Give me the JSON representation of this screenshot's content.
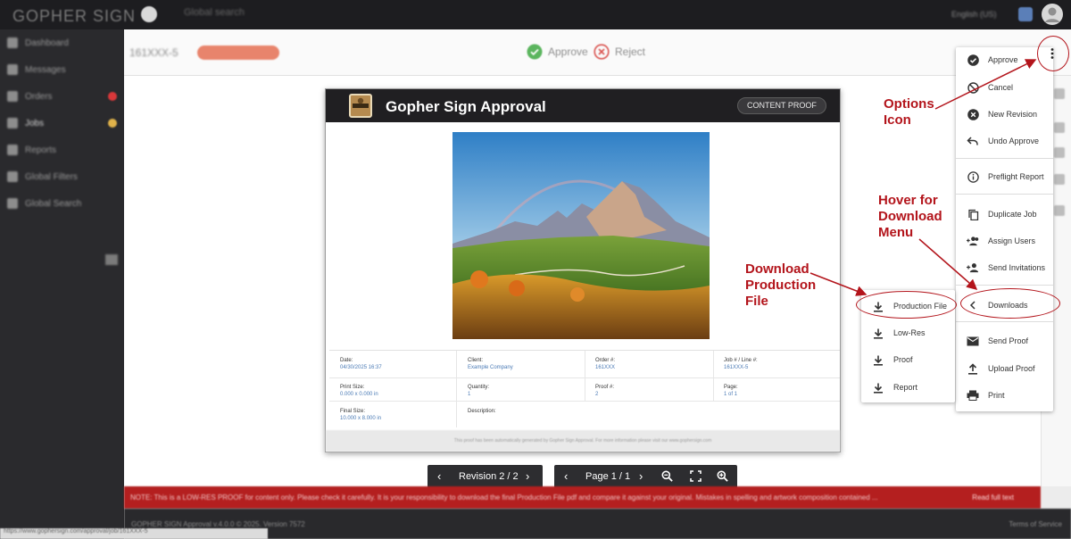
{
  "topbar": {
    "logo": "GOPHER SIGN",
    "search_placeholder": "Global search",
    "language": "English (US)"
  },
  "sidebar": {
    "items": [
      {
        "label": "Dashboard",
        "badge_color": ""
      },
      {
        "label": "Messages",
        "badge_color": ""
      },
      {
        "label": "Orders",
        "badge_color": "#d9383a"
      },
      {
        "label": "Jobs",
        "badge_color": "#e0b24a"
      },
      {
        "label": "Reports",
        "badge_color": ""
      },
      {
        "label": "Global Filters",
        "badge_color": ""
      },
      {
        "label": "Global Search",
        "badge_color": ""
      }
    ]
  },
  "job_header": {
    "job_number": "161XXX-5",
    "status_pill": "Awaiting Client Approval",
    "approve_label": "Approve",
    "reject_label": "Reject"
  },
  "proof": {
    "title": "Gopher Sign Approval",
    "logo_text": "GOPHER SIGN",
    "chip": "CONTENT PROOF",
    "fields": {
      "date_label": "Date:",
      "date_value": "04/30/2025 16:37",
      "client_label": "Client:",
      "client_value": "Example Company",
      "order_label": "Order #:",
      "order_value": "161XXX",
      "job_label": "Job # / Line #:",
      "job_value": "161XXX-5",
      "print_size_label": "Print Size:",
      "print_size_value": "0.000 x 0.000 in",
      "quantity_label": "Quantity:",
      "quantity_value": "1",
      "proof_label": "Proof #:",
      "proof_value": "2",
      "page_label": "Page:",
      "page_value": "1 of 1",
      "final_size_label": "Final Size:",
      "final_size_value": "10.000 x 8.000 in",
      "description_label": "Description:"
    },
    "footer": "This proof has been automatically generated by Gopher Sign Approval. For more information please visit our www.gophersign.com"
  },
  "controls": {
    "revision_label": "Revision 2 / 2",
    "page_label": "Page 1 / 1"
  },
  "notice": {
    "text": "NOTE: This is a LOW-RES PROOF for content only. Please check it carefully. It is your responsibility to download the final Production File pdf and compare it against your original. Mistakes in spelling and artwork composition contained ...",
    "link": "Read full text"
  },
  "footer": {
    "left": "GOPHER SIGN Approval v.4.0.0 © 2025. Version 7572",
    "right": "Terms of Service"
  },
  "status_bar": "https://www.gophersign.com/approval/job/161XXX-5",
  "options_menu": {
    "items": [
      {
        "label": "Approve",
        "icon": "check-circle-icon"
      },
      {
        "label": "Cancel",
        "icon": "cancel-icon"
      },
      {
        "label": "New Revision",
        "icon": "close-circle-icon"
      },
      {
        "label": "Undo Approve",
        "icon": "undo-icon"
      },
      {
        "label": "Preflight Report",
        "icon": "info-icon"
      },
      {
        "label": "Duplicate Job",
        "icon": "copy-icon"
      },
      {
        "label": "Assign Users",
        "icon": "group-add-icon"
      },
      {
        "label": "Send Invitations",
        "icon": "person-add-icon"
      },
      {
        "label": "Downloads",
        "icon": "chevron-left-icon"
      },
      {
        "label": "Send Proof",
        "icon": "mail-icon"
      },
      {
        "label": "Upload Proof",
        "icon": "upload-icon"
      },
      {
        "label": "Print",
        "icon": "print-icon"
      }
    ]
  },
  "downloads_menu": {
    "items": [
      {
        "label": "Production File",
        "icon": "download-icon"
      },
      {
        "label": "Low-Res",
        "icon": "download-icon"
      },
      {
        "label": "Proof",
        "icon": "download-icon"
      },
      {
        "label": "Report",
        "icon": "download-icon"
      }
    ]
  },
  "annotations": {
    "options_line1": "Options",
    "options_line2": "Icon",
    "hover_line1": "Hover for",
    "hover_line2": "Download",
    "hover_line3": "Menu",
    "download_line1": "Download",
    "download_line2": "Production",
    "download_line3": "File"
  },
  "colors": {
    "annotation": "#b3141b",
    "notice": "#b41f1f",
    "approve_green": "#5bb55e",
    "reject_red": "#d9534f"
  }
}
